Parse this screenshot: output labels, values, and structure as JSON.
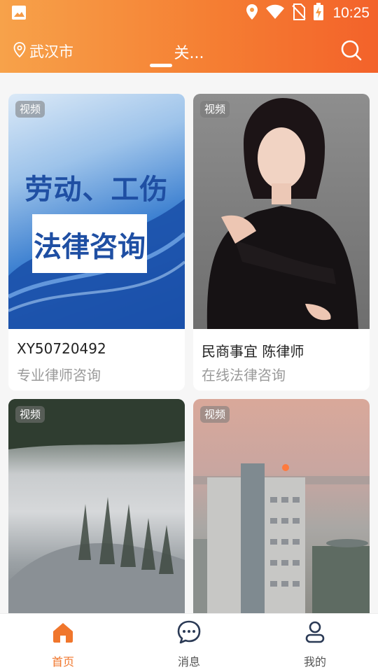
{
  "status_bar": {
    "time": "10:25",
    "icons": [
      "image-notification-icon",
      "location-icon",
      "wifi-icon",
      "no-sim-icon",
      "battery-charging-icon"
    ]
  },
  "header": {
    "location": "武汉市",
    "title": "关...",
    "colors": {
      "gradient_start": "#f7a24a",
      "gradient_end": "#f3622a"
    }
  },
  "cards": [
    {
      "tag": "视频",
      "title": "XY50720492",
      "subtitle": "专业律师咨询",
      "thumb": {
        "line1": "劳动、工伤",
        "line2": "法律咨询"
      }
    },
    {
      "tag": "视频",
      "title": "民商事宜 陈律师",
      "subtitle": "在线法律咨询"
    },
    {
      "tag": "视频"
    },
    {
      "tag": "视频"
    }
  ],
  "bottom_nav": {
    "active": "home",
    "tabs": [
      {
        "id": "home",
        "label": "首页",
        "icon": "home-icon"
      },
      {
        "id": "messages",
        "label": "消息",
        "icon": "chat-icon"
      },
      {
        "id": "profile",
        "label": "我的",
        "icon": "user-icon"
      }
    ],
    "colors": {
      "active": "#f0762c",
      "inactive": "#555555"
    }
  }
}
